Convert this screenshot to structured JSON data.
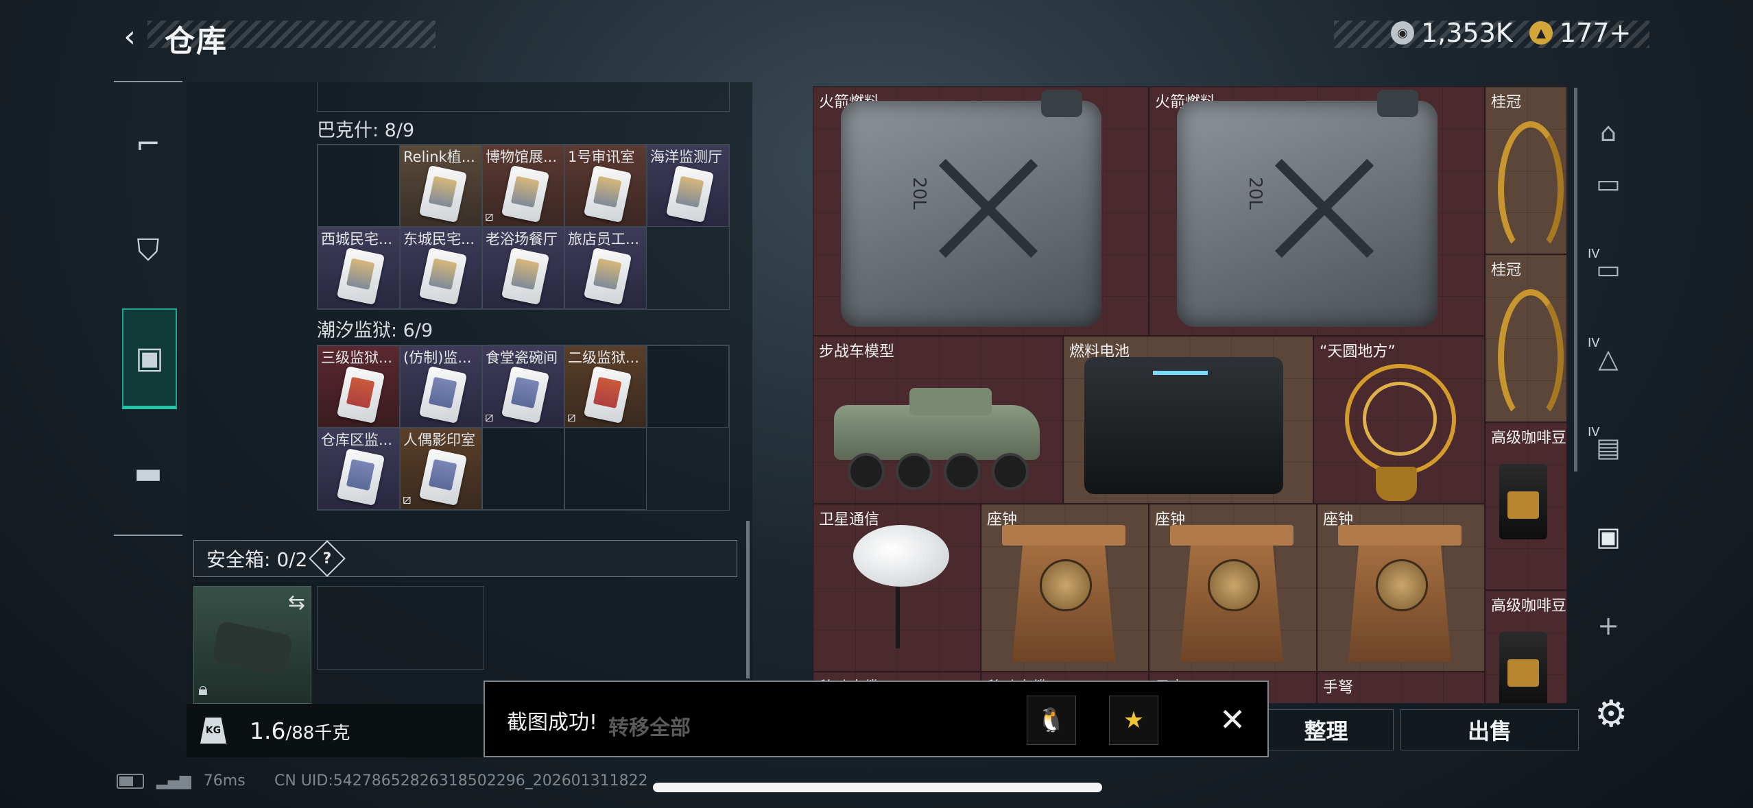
{
  "header": {
    "back_icon": "‹",
    "title": "仓库"
  },
  "currencies": [
    {
      "icon": "silver-coin-icon",
      "value": "1,353K",
      "color": "#c8ccd0"
    },
    {
      "icon": "gold-coin-icon",
      "value": "177+",
      "color": "#d4a63a"
    }
  ],
  "nav": {
    "items": [
      "weapon",
      "backpack",
      "storage",
      "toolbox"
    ]
  },
  "left": {
    "section1": {
      "title": "巴克什: 8/9",
      "slots": [
        {
          "label": "",
          "color": "empty",
          "card": ""
        },
        {
          "label": "Relink植...",
          "color": "gold",
          "card": "gold"
        },
        {
          "label": "博物馆展...",
          "color": "brown",
          "card": "gold",
          "nokey": true
        },
        {
          "label": "1号审讯室",
          "color": "brown",
          "card": "gold"
        },
        {
          "label": "海洋监测厅",
          "color": "purple",
          "card": "gold"
        },
        {
          "label": "西城民宅...",
          "color": "purple",
          "card": "gold"
        },
        {
          "label": "东城民宅...",
          "color": "purple",
          "card": "gold"
        },
        {
          "label": "老浴场餐厅",
          "color": "purple",
          "card": "gold"
        },
        {
          "label": "旅店员工...",
          "color": "purple",
          "card": "gold"
        }
      ]
    },
    "section2": {
      "title": "潮汐监狱: 6/9",
      "slots": [
        {
          "label": "三级监狱...",
          "color": "red",
          "card": "red"
        },
        {
          "label": "(仿制)监...",
          "color": "purple",
          "card": "blue"
        },
        {
          "label": "食堂瓷碗间",
          "color": "purple",
          "card": "blue",
          "nokey": true
        },
        {
          "label": "二级监狱...",
          "color": "orange",
          "card": "red",
          "nokey": true
        },
        {
          "label": "",
          "color": "empty",
          "card": ""
        },
        {
          "label": "仓库区监...",
          "color": "purple",
          "card": "blue"
        },
        {
          "label": "人偶影印室",
          "color": "orange",
          "card": "blue",
          "nokey": true
        }
      ]
    },
    "safebox": {
      "label": "安全箱: 0/2",
      "help": "?"
    },
    "weight": {
      "current": "1.6",
      "max": "/88千克",
      "kg_icon": "KG"
    }
  },
  "stash": {
    "items": {
      "fuel1": "火箭燃料",
      "fuel2": "火箭燃料",
      "laurel1": "桂冠",
      "laurel2": "桂冠",
      "apc": "步战车模型",
      "battery": "燃料电池",
      "globe": "“天圆地方”",
      "coffee1": "高级咖啡豆",
      "coffee2": "高级咖啡豆",
      "sat": "卫星通信",
      "clock1": "座钟",
      "clock2": "座钟",
      "clock3": "座钟",
      "b1": "移动电缆",
      "b2": "移动电缆",
      "b3": "风卡",
      "b4": "手弩"
    },
    "jerry_label": "20L"
  },
  "buttons": {
    "sort": "整理",
    "sell": "出售",
    "move_all": "转移全部"
  },
  "toast": {
    "text": "截图成功!",
    "qq_icon": "🐧",
    "qzone_icon": "★",
    "close_icon": "✕"
  },
  "status": {
    "ping": "76ms",
    "uid": "CN UID:54278652826318502296_202601311822"
  },
  "right_tools": {
    "plus": "+",
    "tier": "IV"
  }
}
